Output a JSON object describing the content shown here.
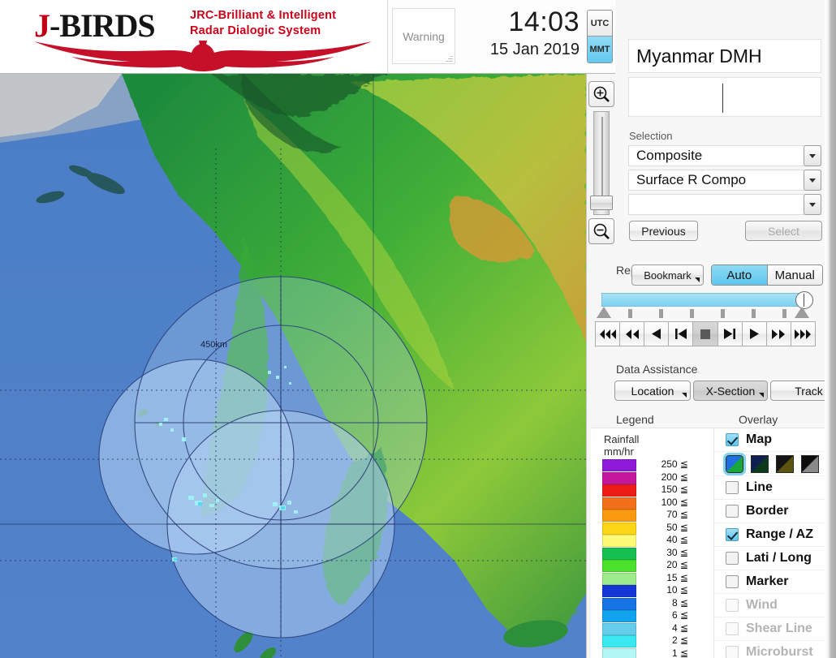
{
  "header": {
    "logo_main_j": "J",
    "logo_main_rest": "-BIRDS",
    "logo_sub_line1": "JRC-Brilliant & Intelligent",
    "logo_sub_line2": "Radar  Dialogic  System",
    "warning_label": "Warning",
    "time": "14:03",
    "date": "15 Jan 2019",
    "tz_utc": "UTC",
    "tz_mmt": "MMT",
    "toolbar": [
      {
        "name": "save-button",
        "icon": "save-icon"
      },
      {
        "name": "print-button",
        "icon": "print-icon"
      },
      {
        "name": "open-folder-button",
        "icon": "folder-open-icon"
      },
      {
        "name": "add-image-button",
        "icon": "image-add-icon"
      },
      {
        "name": "help-button",
        "icon": "question-icon"
      }
    ]
  },
  "map": {
    "range_ring_label": "450km",
    "zoom_in_icon": "zoom-in-icon",
    "zoom_out_icon": "zoom-out-icon"
  },
  "panel": {
    "site_title": "Myanmar DMH",
    "selection_label": "Selection",
    "select_1": "Composite",
    "select_2": "Surface R Compo",
    "select_3": "",
    "previous_label": "Previous",
    "select_label": "Select"
  },
  "replay": {
    "label": "Replay",
    "bookmark_label": "Bookmark",
    "auto_label": "Auto",
    "manual_label": "Manual",
    "auto_selected": true,
    "slider_position_pct": 97,
    "transport": [
      {
        "name": "skip-to-start-button",
        "icon": "rewind-all-icon"
      },
      {
        "name": "rewind-button",
        "icon": "rewind-icon"
      },
      {
        "name": "step-back-button",
        "icon": "play-back-icon"
      },
      {
        "name": "previous-frame-button",
        "icon": "prev-frame-icon"
      },
      {
        "name": "stop-button",
        "icon": "stop-icon"
      },
      {
        "name": "next-frame-button",
        "icon": "next-frame-icon"
      },
      {
        "name": "play-button",
        "icon": "play-icon"
      },
      {
        "name": "fast-forward-button",
        "icon": "fast-forward-icon"
      },
      {
        "name": "skip-to-end-button",
        "icon": "forward-all-icon"
      }
    ]
  },
  "data_assistance": {
    "label": "Data Assistance",
    "location_label": "Location",
    "xsection_label": "X-Section",
    "track_label": "Track"
  },
  "legend": {
    "label": "Legend",
    "unit_line1": "Rainfall",
    "unit_line2": "mm/hr",
    "le_symbol": "≦",
    "rows": [
      {
        "value": "250",
        "color": "#8e1ad8"
      },
      {
        "value": "200",
        "color": "#c4189c"
      },
      {
        "value": "150",
        "color": "#ec1c16"
      },
      {
        "value": "100",
        "color": "#f2701a"
      },
      {
        "value": "70",
        "color": "#fa9a10"
      },
      {
        "value": "50",
        "color": "#fcd516"
      },
      {
        "value": "40",
        "color": "#fdfa76"
      },
      {
        "value": "30",
        "color": "#16c04e"
      },
      {
        "value": "20",
        "color": "#4ae02c"
      },
      {
        "value": "15",
        "color": "#9eeb8c"
      },
      {
        "value": "10",
        "color": "#1636d6"
      },
      {
        "value": "8",
        "color": "#1673e4"
      },
      {
        "value": "6",
        "color": "#12a3ee"
      },
      {
        "value": "4",
        "color": "#66ccec"
      },
      {
        "value": "2",
        "color": "#3ae8f2"
      },
      {
        "value": "1",
        "color": "#b2f6f6"
      }
    ]
  },
  "overlay": {
    "label": "Overlay",
    "items": [
      {
        "name": "map",
        "label": "Map",
        "checked": true,
        "enabled": true
      },
      {
        "name": "line",
        "label": "Line",
        "checked": false,
        "enabled": true
      },
      {
        "name": "border",
        "label": "Border",
        "checked": false,
        "enabled": true
      },
      {
        "name": "range-az",
        "label": "Range / AZ",
        "checked": true,
        "enabled": true
      },
      {
        "name": "lati-long",
        "label": "Lati / Long",
        "checked": false,
        "enabled": true
      },
      {
        "name": "marker",
        "label": "Marker",
        "checked": false,
        "enabled": true
      },
      {
        "name": "wind",
        "label": "Wind",
        "checked": false,
        "enabled": false
      },
      {
        "name": "shear-line",
        "label": "Shear Line",
        "checked": false,
        "enabled": false
      },
      {
        "name": "microburst",
        "label": "Microburst",
        "checked": false,
        "enabled": false
      }
    ],
    "map_styles": [
      {
        "name": "map-style-color",
        "top": "#1f6fe0",
        "bottom": "#18a83a",
        "selected": true
      },
      {
        "name": "map-style-dark-blue",
        "top": "#101f52",
        "bottom": "#0b3a1c",
        "selected": false
      },
      {
        "name": "map-style-olive",
        "top": "#141414",
        "bottom": "#5c5410",
        "selected": false
      },
      {
        "name": "map-style-gray",
        "top": "#0d0d0d",
        "bottom": "#8a8a8a",
        "selected": false
      }
    ]
  }
}
